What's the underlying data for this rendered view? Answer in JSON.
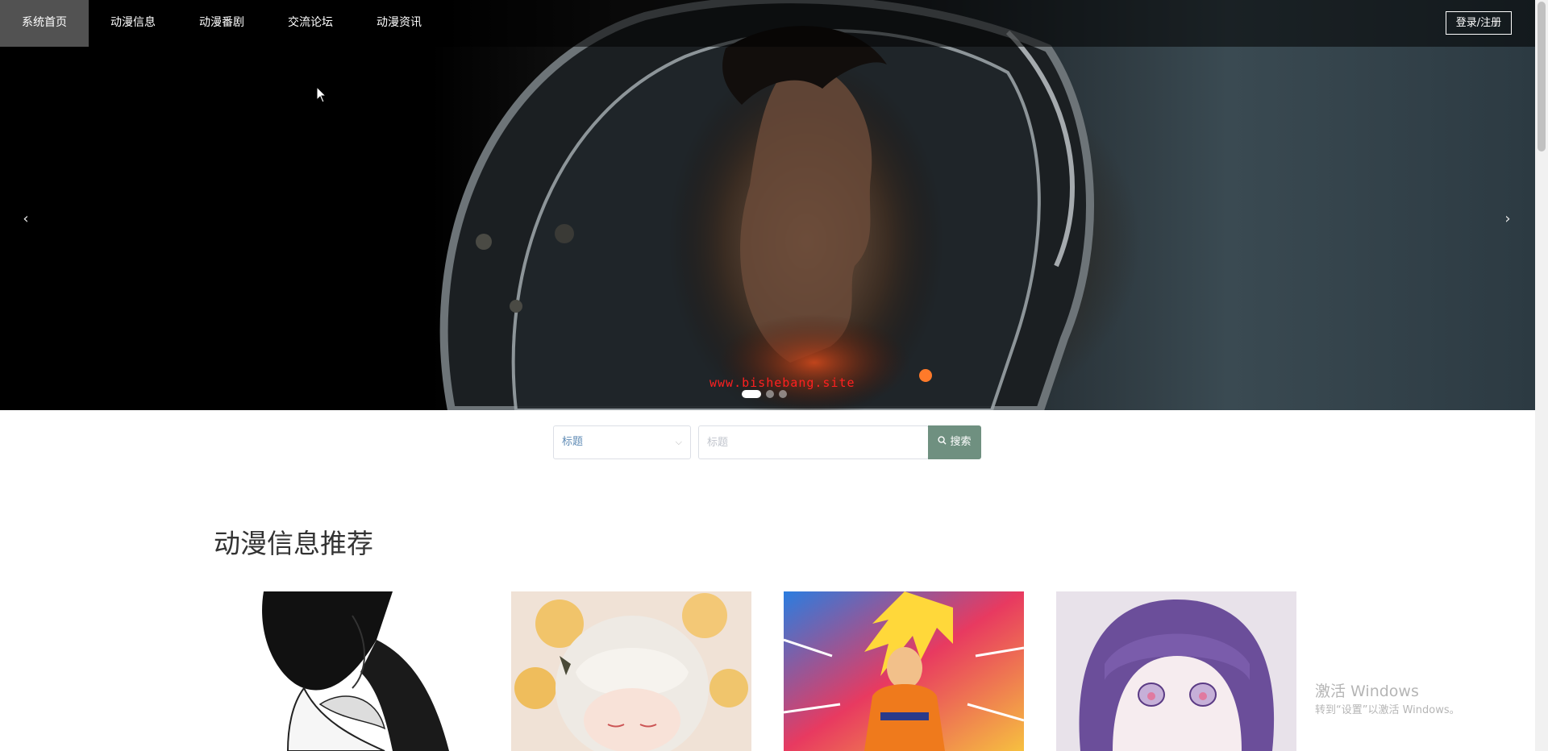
{
  "nav": {
    "items": [
      {
        "label": "系统首页",
        "active": true
      },
      {
        "label": "动漫信息",
        "active": false
      },
      {
        "label": "动漫番剧",
        "active": false
      },
      {
        "label": "交流论坛",
        "active": false
      },
      {
        "label": "动漫资讯",
        "active": false
      }
    ],
    "login_label": "登录/注册"
  },
  "carousel": {
    "prev_icon": "chevron-left-icon",
    "next_icon": "chevron-right-icon",
    "watermark_text": "www.bishebang.site",
    "slide_count": 3,
    "active_index": 0
  },
  "search": {
    "select_value": "标题",
    "input_placeholder": "标题",
    "button_label": "搜索",
    "button_icon": "search-icon"
  },
  "section": {
    "title": "动漫信息推荐"
  },
  "os_watermark": {
    "title": "激活 Windows",
    "subtitle": "转到“设置”以激活 Windows。"
  },
  "colors": {
    "search_button": "#6f9080",
    "select_text": "#5f8bb5",
    "watermark_red": "#ff2020"
  }
}
